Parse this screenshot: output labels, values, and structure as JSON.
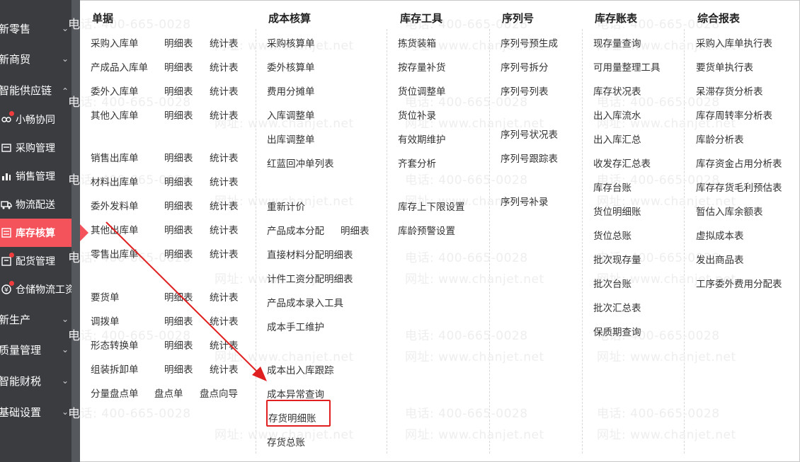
{
  "sidebar": {
    "groups": [
      {
        "label": "新零售"
      },
      {
        "label": "新商贸"
      },
      {
        "label": "智能供应链"
      },
      {
        "label": "新生产"
      },
      {
        "label": "质量管理"
      },
      {
        "label": "智能财税"
      },
      {
        "label": "基础设置"
      }
    ],
    "subs": [
      {
        "label": "小畅协同",
        "icon": "coordinate-icon"
      },
      {
        "label": "采购管理",
        "icon": "purchase-icon"
      },
      {
        "label": "销售管理",
        "icon": "sales-chart-icon"
      },
      {
        "label": "物流配送",
        "icon": "logistics-icon"
      },
      {
        "label": "库存核算",
        "icon": "inventory-icon"
      },
      {
        "label": "配货管理",
        "icon": "distribution-icon"
      },
      {
        "label": "仓储物流工资",
        "icon": "wage-icon"
      }
    ]
  },
  "columns": {
    "c1": {
      "header": "单据",
      "items": [
        "采购入库单",
        "明细表",
        "统计表",
        "产成品入库单",
        "明细表",
        "统计表",
        "委外入库单",
        "明细表",
        "统计表",
        "其他入库单",
        "明细表",
        "统计表",
        "销售出库单",
        "明细表",
        "统计表",
        "材料出库单",
        "明细表",
        "统计表",
        "委外发料单",
        "明细表",
        "统计表",
        "其他出库单",
        "明细表",
        "统计表",
        "零售出库单",
        "明细表",
        "统计表",
        "要货单",
        "明细表",
        "统计表",
        "调拨单",
        "明细表",
        "统计表",
        "形态转换单",
        "明细表",
        "统计表",
        "组装拆卸单",
        "明细表",
        "统计表",
        "分量盘点单",
        "盘点单",
        "盘点向导"
      ]
    },
    "c2": {
      "header": "成本核算",
      "items": [
        "采购核算单",
        "委外核算单",
        "费用分摊单",
        "入库调整单",
        "出库调整单",
        "红蓝回冲单列表",
        "重新计价",
        "产品成本分配",
        "明细表",
        "直接材料分配明细表",
        "计件工资分配明细表",
        "产品成本录入工具",
        "成本手工维护",
        "成本出入库跟踪",
        "成本异常查询",
        "存货明细账",
        "存货总账"
      ]
    },
    "c3": {
      "header": "库存工具",
      "items": [
        "拣货装箱",
        "按存量补货",
        "货位调整单",
        "货位补录",
        "有效期维护",
        "齐套分析",
        "库存上下限设置",
        "库龄预警设置"
      ]
    },
    "c4": {
      "header": "序列号",
      "items": [
        "序列号预生成",
        "序列号拆分",
        "序列号列表",
        "序列号状况表",
        "序列号跟踪表",
        "序列号补录"
      ]
    },
    "c5": {
      "header": "库存账表",
      "items": [
        "现存量查询",
        "可用量整理工具",
        "库存状况表",
        "出入库流水",
        "出入库汇总",
        "收发存汇总表",
        "库存台账",
        "货位明细账",
        "货位总账",
        "批次现存量",
        "批次台账",
        "批次汇总表",
        "保质期查询"
      ]
    },
    "c6": {
      "header": "综合报表",
      "items": [
        "采购入库单执行表",
        "要货单执行表",
        "呆滞存货分析表",
        "库存周转率分析表",
        "库龄分析表",
        "库存资金占用分析表",
        "库存存货毛利预估表",
        "暂估入库余额表",
        "虚拟成本表",
        "发出商品表",
        "工序委外费用分配表"
      ]
    }
  },
  "watermark": {
    "phone": "电话: 400-665-0028",
    "site": "网址: www.chanjet.net"
  },
  "colors": {
    "sidebar_bg": "#3a3c40",
    "active_bg": "#f4535b",
    "annotation": "#e02020"
  }
}
